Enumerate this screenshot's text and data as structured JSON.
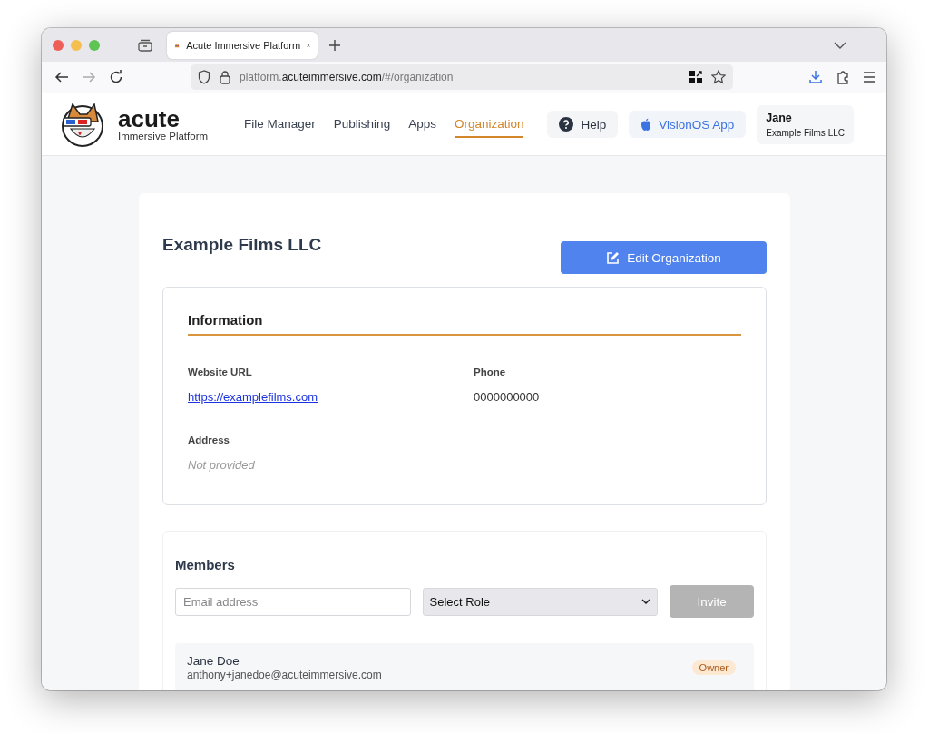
{
  "browser": {
    "tab_title": "Acute Immersive Platform",
    "url_host_prefix": "platform.",
    "url_domain": "acuteimmersive.com",
    "url_path": "/#/organization"
  },
  "brand": {
    "name": "acute",
    "tagline": "Immersive Platform"
  },
  "nav": [
    {
      "label": "File Manager",
      "selected": false
    },
    {
      "label": "Publishing",
      "selected": false
    },
    {
      "label": "Apps",
      "selected": false
    },
    {
      "label": "Organization",
      "selected": true
    }
  ],
  "help_button": "Help",
  "vision_button": "VisionOS App",
  "user": {
    "name": "Jane",
    "org": "Example Films LLC"
  },
  "organization": {
    "title": "Example Films LLC",
    "edit_button": "Edit Organization"
  },
  "information": {
    "heading": "Information",
    "fields": [
      {
        "label": "Website URL",
        "value": "https://examplefilms.com",
        "kind": "link"
      },
      {
        "label": "Phone",
        "value": "0000000000",
        "kind": "text"
      },
      {
        "label": "Address",
        "value": "Not provided",
        "kind": "empty"
      }
    ]
  },
  "members": {
    "heading": "Members",
    "email": {
      "placeholder": "Email address"
    },
    "role_select": "Select Role",
    "invite_button": "Invite",
    "invite_disabled": true,
    "list": [
      {
        "name": "Jane Doe",
        "email": "anthony+janedoe@acuteimmersive.com",
        "role": "Owner"
      }
    ]
  }
}
